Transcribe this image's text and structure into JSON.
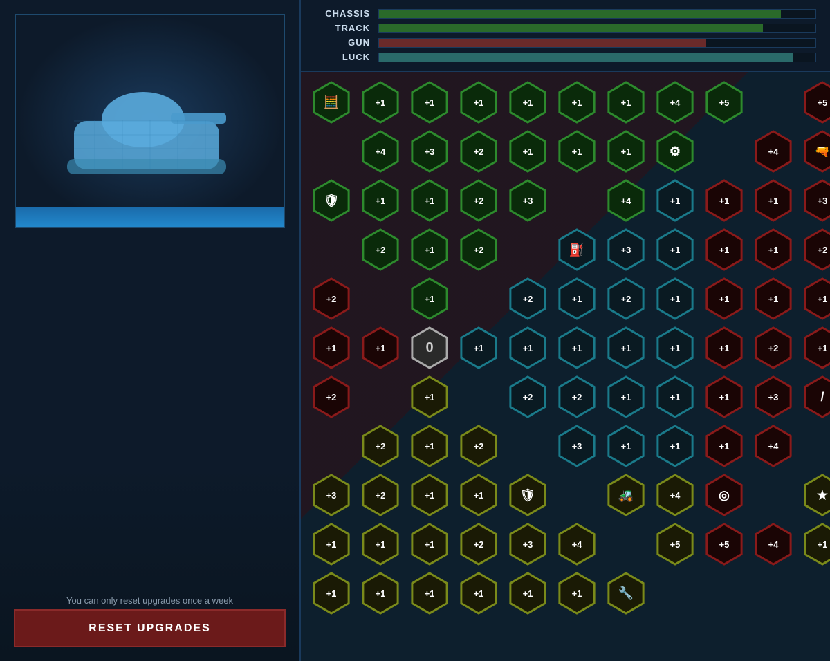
{
  "leftPanel": {
    "resetNotice": "You can only reset upgrades once a week",
    "resetButtonLabel": "RESET UPGRADES"
  },
  "stats": [
    {
      "label": "CHASSIS",
      "fill": 0.92,
      "color": "#2a6a2a"
    },
    {
      "label": "TRACK",
      "fill": 0.88,
      "color": "#2a6a2a"
    },
    {
      "label": "GUN",
      "fill": 0.75,
      "color": "#6a2a2a"
    },
    {
      "label": "LUCK",
      "fill": 0.95,
      "color": "#2a6a6a"
    }
  ],
  "grid": {
    "rows": [
      [
        "green-chip",
        "green+1",
        "green+1",
        "green+1",
        "green+1",
        "green+1",
        "green+1",
        "green+4",
        "green+5",
        "empty"
      ],
      [
        "red+5",
        "empty",
        "green+4",
        "green+3",
        "green+2",
        "green+1",
        "green+1",
        "green+1",
        "green-circles",
        "empty"
      ],
      [
        "red+4",
        "red-gun",
        "green-shield",
        "green+1",
        "green+1",
        "green+2",
        "green+3",
        "empty",
        "green+4",
        "teal+1"
      ],
      [
        "red+1",
        "red+1",
        "red+3",
        "empty",
        "green+2",
        "green+1",
        "green+2",
        "empty",
        "teal-fuel",
        "teal+3",
        "teal+1"
      ],
      [
        "red+1",
        "red+1",
        "red+2",
        "red+2",
        "empty",
        "green+1",
        "empty",
        "teal+2",
        "teal+1",
        "teal+2",
        "teal+1"
      ],
      [
        "red+1",
        "red+1",
        "red+1",
        "red+1",
        "red+1",
        "center0",
        "teal+1",
        "teal+1",
        "teal+1",
        "teal+1",
        "teal+1"
      ],
      [
        "red+1",
        "red+2",
        "red+1",
        "red+2",
        "empty",
        "olive+1",
        "empty",
        "teal+2",
        "teal+2",
        "teal+1",
        "teal+1"
      ],
      [
        "red+1",
        "red+3",
        "red-slash",
        "empty",
        "olive+2",
        "olive+1",
        "olive+2",
        "empty",
        "teal+3",
        "teal+1",
        "teal+1"
      ],
      [
        "red+1",
        "red+4",
        "empty",
        "olive+3",
        "olive+2",
        "olive+1",
        "olive+1",
        "olive-shield",
        "empty",
        "olive-tank",
        "olive+4"
      ],
      [
        "red-target",
        "empty",
        "olive-star",
        "olive+1",
        "olive+1",
        "olive+1",
        "olive+2",
        "olive+3",
        "olive+4",
        "empty",
        "olive+5"
      ],
      [
        "red+5",
        "red+4",
        "olive+1",
        "olive+1",
        "olive+1",
        "olive+1",
        "olive+1",
        "olive+1",
        "olive+1",
        "olive-wrench"
      ]
    ]
  }
}
